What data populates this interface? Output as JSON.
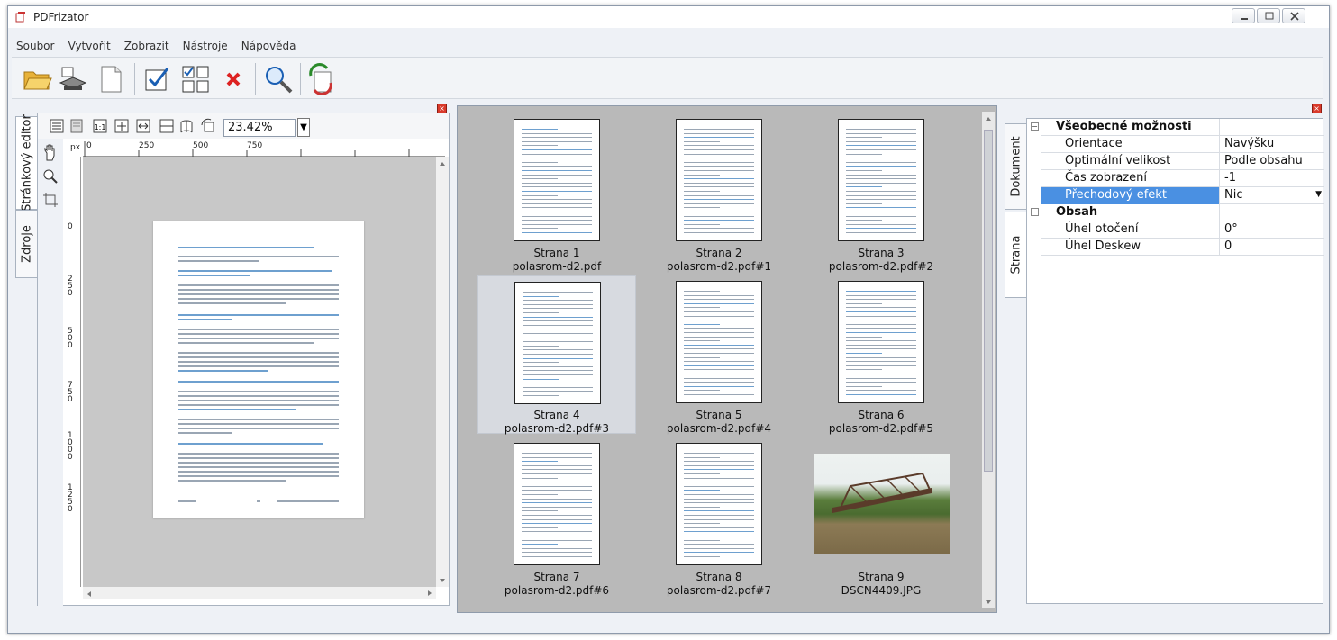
{
  "window": {
    "title": "PDFrizator"
  },
  "menu": [
    "Soubor",
    "Vytvořit",
    "Zobrazit",
    "Nástroje",
    "Nápověda"
  ],
  "toolbar": {
    "icons": [
      "open-folder-icon",
      "scan-icon",
      "new-page-icon",
      "check-all-icon",
      "uncheck-icon",
      "delete-icon",
      "search-icon",
      "convert-icon"
    ]
  },
  "left_panel": {
    "tabs": [
      "Stránkový editor",
      "Zdroje"
    ],
    "zoom": "23.42%",
    "ruler_unit": "px",
    "ruler_top": [
      "0",
      "250",
      "500",
      "750"
    ],
    "ruler_left": [
      "0",
      "2\n5\n0",
      "5\n0\n0",
      "7\n5\n0",
      "1\n0\n0\n0",
      "1\n2\n5\n0",
      "1\n5\n0\n0"
    ]
  },
  "thumbnails": [
    {
      "page": "Strana 1",
      "file": "polasrom-d2.pdf"
    },
    {
      "page": "Strana 2",
      "file": "polasrom-d2.pdf#1"
    },
    {
      "page": "Strana 3",
      "file": "polasrom-d2.pdf#2"
    },
    {
      "page": "Strana 4",
      "file": "polasrom-d2.pdf#3"
    },
    {
      "page": "Strana 5",
      "file": "polasrom-d2.pdf#4"
    },
    {
      "page": "Strana 6",
      "file": "polasrom-d2.pdf#5"
    },
    {
      "page": "Strana 7",
      "file": "polasrom-d2.pdf#6"
    },
    {
      "page": "Strana 8",
      "file": "polasrom-d2.pdf#7"
    },
    {
      "page": "Strana 9",
      "file": "DSCN4409.JPG"
    }
  ],
  "right_panel": {
    "tabs": [
      "Dokument",
      "Strana"
    ],
    "categories": [
      {
        "label": "Všeobecné možnosti",
        "expander": "−"
      },
      {
        "label": "Obsah",
        "expander": "−"
      }
    ],
    "properties": [
      {
        "key": "Orientace",
        "value": "Navýšku"
      },
      {
        "key": "Optimální velikost",
        "value": "Podle obsahu"
      },
      {
        "key": "Čas zobrazení",
        "value": "-1"
      },
      {
        "key": "Přechodový efekt",
        "value": "Nic"
      },
      {
        "key": "Úhel otočení",
        "value": "0°"
      },
      {
        "key": "Úhel Deskew",
        "value": "0"
      }
    ]
  },
  "colors": {
    "selection": "#4a90e2",
    "canvas": "#c8c8c8",
    "thumb_bg": "#b9b9b9"
  }
}
